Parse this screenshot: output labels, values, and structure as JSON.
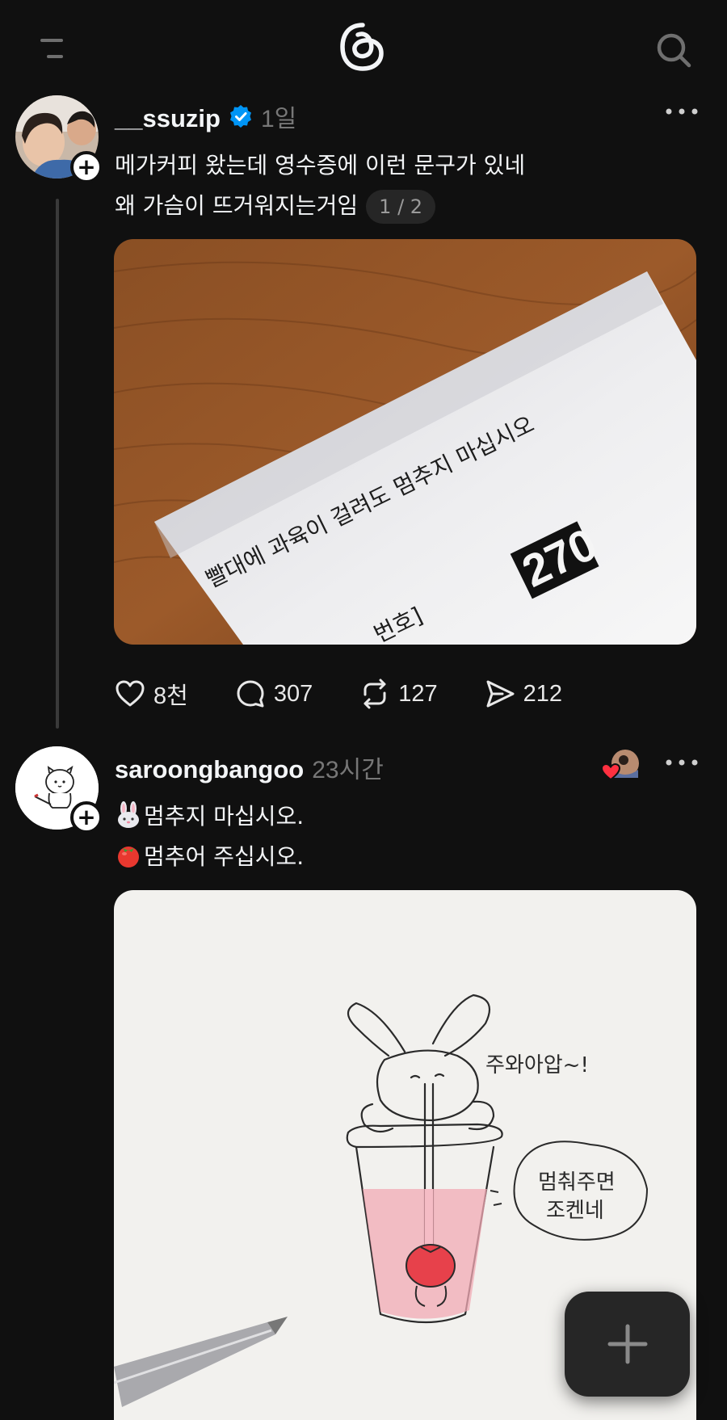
{
  "app": {
    "name": "Threads"
  },
  "icons": {
    "menu": "menu-icon",
    "logo": "threads-logo-icon",
    "search": "search-icon",
    "more": "more-icon",
    "like": "heart-icon",
    "reply": "comment-icon",
    "repost": "repost-icon",
    "share": "send-icon",
    "compose": "plus-icon"
  },
  "colors": {
    "background": "#101010",
    "verified": "#0095f6",
    "text": "#f3f5f7",
    "muted": "#777777"
  },
  "posts": [
    {
      "username": "__ssuzip",
      "verified": true,
      "timestamp": "1일",
      "lines": [
        "메가커피 왔는데 영수증에 이런 문구가 있네",
        "왜 가슴이 뜨거워지는거임"
      ],
      "media_counter": "1 / 2",
      "media_text": {
        "receipt_message": "빨대에 과육이 걸려도 멈추지 마십시오",
        "number_label": "번호]",
        "order_number": "270"
      },
      "stats": {
        "likes": "8천",
        "replies": "307",
        "reposts": "127",
        "shares": "212"
      }
    },
    {
      "username": "saroongbangoo",
      "timestamp": "23시간",
      "lines": [
        "멈추지 마십시오.",
        "멈추어 주십시오."
      ],
      "line_emojis": [
        "rabbit-face-emoji",
        "tomato-emoji"
      ],
      "media_text": {
        "speech_1": "주와아압~!",
        "speech_2_line1": "멈춰주면",
        "speech_2_line2": "조켄네"
      }
    }
  ]
}
